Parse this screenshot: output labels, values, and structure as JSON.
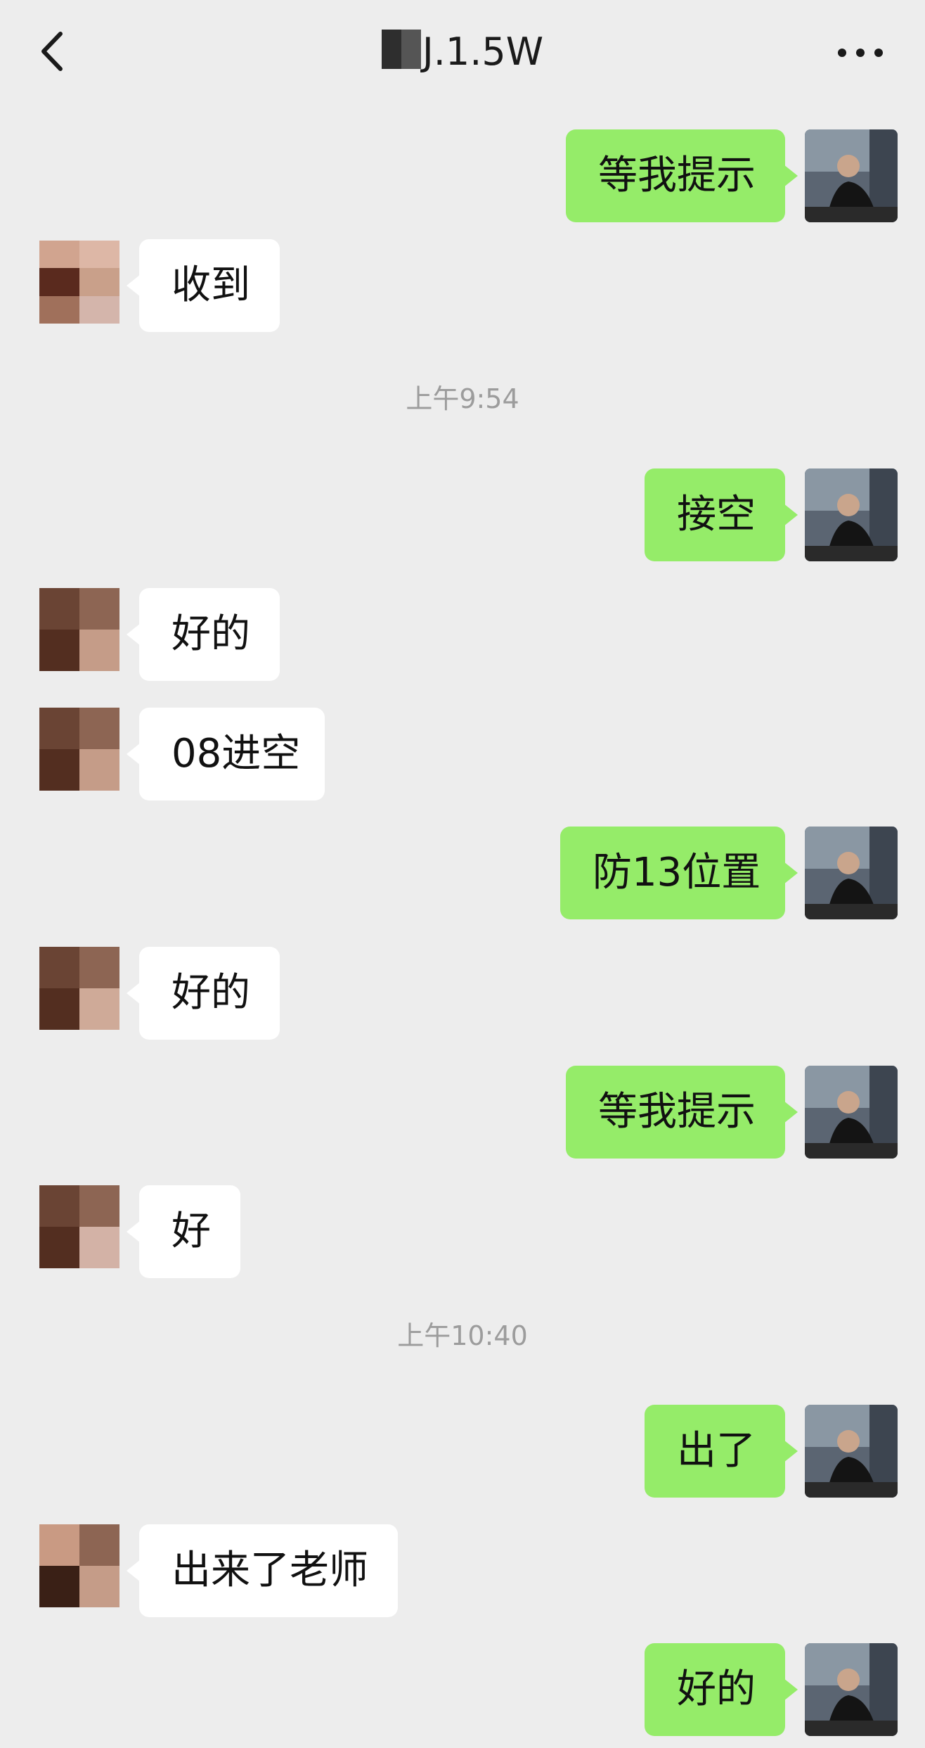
{
  "header": {
    "title": "J.1.5W",
    "back_icon": "chevron-left-icon",
    "more_icon": "more-horizontal-icon"
  },
  "messages": [
    {
      "side": "out",
      "text": "等我提示"
    },
    {
      "side": "in",
      "text": "收到"
    },
    {
      "side": "time",
      "text": "上午9:54"
    },
    {
      "side": "out",
      "text": "接空"
    },
    {
      "side": "in",
      "text": "好的"
    },
    {
      "side": "in",
      "text": "08进空"
    },
    {
      "side": "out",
      "text": "防13位置"
    },
    {
      "side": "in",
      "text": "好的"
    },
    {
      "side": "out",
      "text": "等我提示"
    },
    {
      "side": "in",
      "text": "好"
    },
    {
      "side": "time",
      "text": "上午10:40"
    },
    {
      "side": "out",
      "text": "出了"
    },
    {
      "side": "in",
      "text": "出来了老师"
    },
    {
      "side": "out",
      "text": "好的"
    }
  ],
  "colors": {
    "background": "#ededed",
    "outgoing_bubble": "#95ec69",
    "incoming_bubble": "#ffffff",
    "timestamp": "#9c9c9c"
  }
}
